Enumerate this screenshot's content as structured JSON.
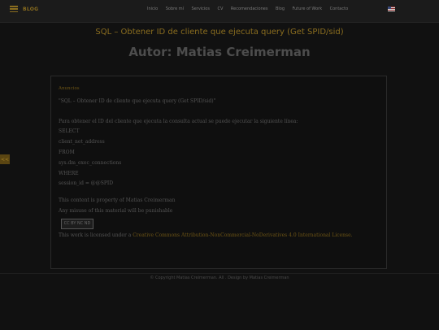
{
  "header": {
    "brand": "BLOG",
    "nav": [
      "Inicio",
      "Sobre mí",
      "Servicios",
      "CV",
      "Recomendaciones",
      "Blog",
      "Future of Work",
      "Contacto"
    ],
    "language_flag": "us-flag-icon"
  },
  "post": {
    "title": "SQL – Obtener ID de cliente que ejecuta query (Get SPID/sid)",
    "author_heading": "Autor: Matias Creimerman"
  },
  "card": {
    "section_label": "Anuncios",
    "lines": [
      "\"SQL – Obtener ID de cliente que ejecuta query (Get SPID/sid)\"",
      "",
      "Para obtener el ID del cliente que ejecuta la consulta actual se puede ejecutar la siguiente línea:",
      "SELECT",
      "client_net_address",
      "FROM",
      "sys.dm_exec_connections",
      "WHERE",
      "session_id = @@SPID"
    ],
    "notice_1": "This content is property of Matias Creimerman",
    "notice_2": "Any misuse of this material will be punishable",
    "cc_badge": "CC BY NC ND",
    "license_prefix": "This work is licensed under a ",
    "license_link": "Creative Commons Attribution-NonCommercial-NoDerivatives 4.0 International License."
  },
  "side_tab": "<<",
  "footer": {
    "copyright": "© Copyright Matias Creimerman. All . Design by Matias Creimerman"
  },
  "colors": {
    "accent": "#8a6d1f",
    "background": "#111111"
  }
}
